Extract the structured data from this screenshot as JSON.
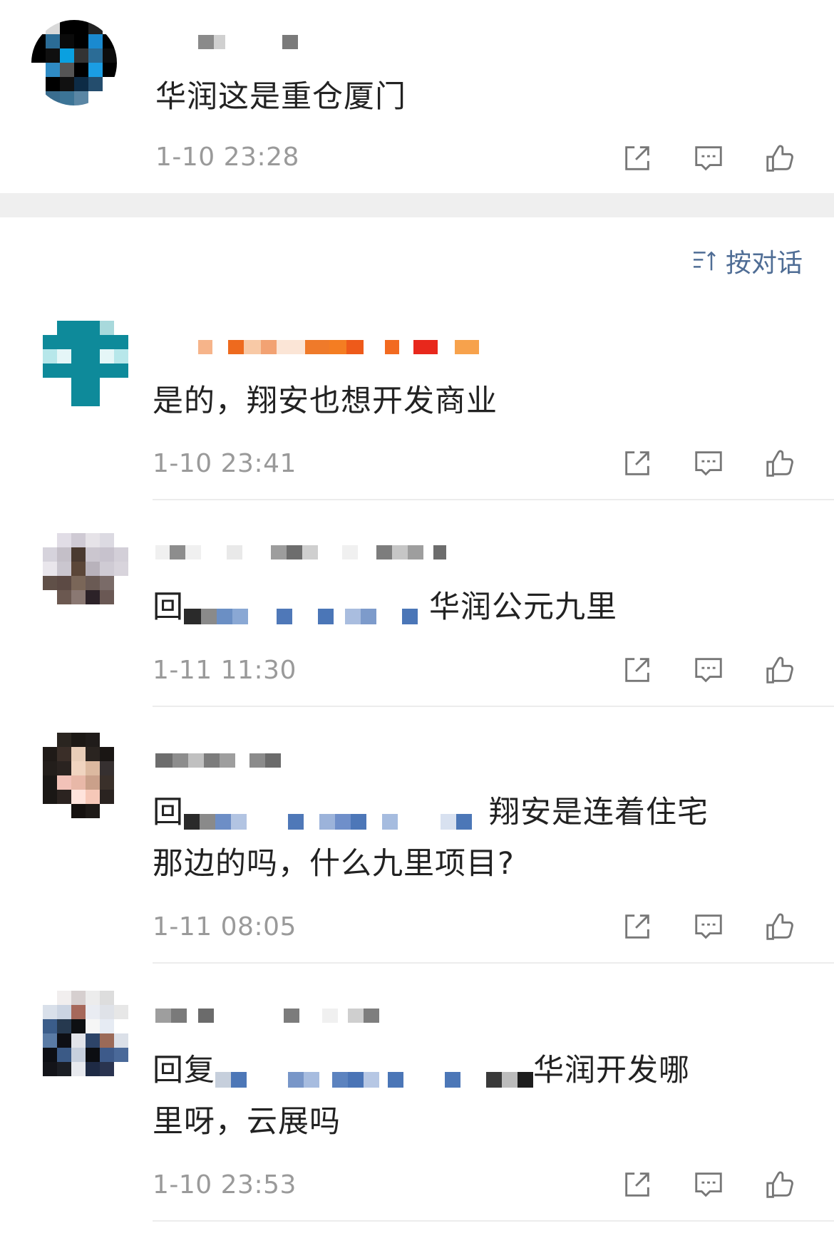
{
  "top_comment": {
    "text": "华润这是重仓厦门",
    "time": "1-10 23:28"
  },
  "sort_toggle": {
    "label": "按对话",
    "icon": "sort-icon"
  },
  "comments": [
    {
      "text": "是的，翔安也想开发商业",
      "time": "1-10 23:41"
    },
    {
      "text_prefix": "回",
      "text_suffix": "华润公元九里",
      "time": "1-11 11:30"
    },
    {
      "text_prefix": "回",
      "text_line1_suffix": "翔安是连着住宅",
      "text_line2": "那边的吗，什么九里项目?",
      "time": "1-11 08:05"
    },
    {
      "text_prefix": "回复",
      "text_line1_suffix": "华润开发哪",
      "text_line2": "里呀，云展吗",
      "time": "1-10 23:53"
    }
  ],
  "actions": {
    "share_icon": "share-icon",
    "reply_icon": "comment-icon",
    "like_icon": "thumbs-up-icon"
  },
  "colors": {
    "accent": "#4f6d95",
    "time": "#9a9a9a",
    "separator": "#efefef"
  }
}
